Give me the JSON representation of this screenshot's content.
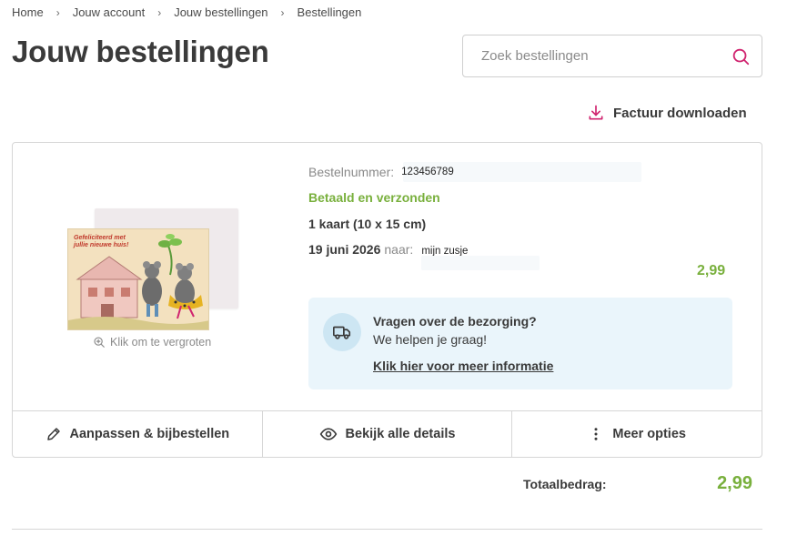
{
  "breadcrumb": [
    "Home",
    "Jouw account",
    "Jouw bestellingen",
    "Bestellingen"
  ],
  "page_title": "Jouw bestellingen",
  "search": {
    "placeholder": "Zoek bestellingen",
    "icon": "search-icon"
  },
  "invoice": {
    "label": "Factuur downloaden",
    "icon": "download-icon"
  },
  "order": {
    "number_label": "Bestelnummer:",
    "number_value": "123456789",
    "status": "Betaald en verzonden",
    "product": "1 kaart (10 x 15 cm)",
    "date": "19 juni 2026",
    "to_label": "naar:",
    "recipient": "mijn zusje",
    "price": "2,99",
    "card_text": "Gefeliciteerd met jullie nieuwe huis!",
    "zoom_hint": "Klik om te vergroten"
  },
  "delivery": {
    "title": "Vragen over de bezorging?",
    "subtitle": "We helpen je graag!",
    "link": "Klik hier voor meer informatie",
    "icon": "truck-icon"
  },
  "actions": [
    {
      "label": "Aanpassen & bijbestellen",
      "icon": "pencil-icon"
    },
    {
      "label": "Bekijk alle details",
      "icon": "eye-icon"
    },
    {
      "label": "Meer opties",
      "icon": "more-vertical-icon"
    }
  ],
  "total": {
    "label": "Totaalbedrag:",
    "value": "2,99"
  },
  "colors": {
    "accent_green": "#79b03d",
    "accent_pink": "#d0246f",
    "info_bg": "#eaf5fb"
  }
}
